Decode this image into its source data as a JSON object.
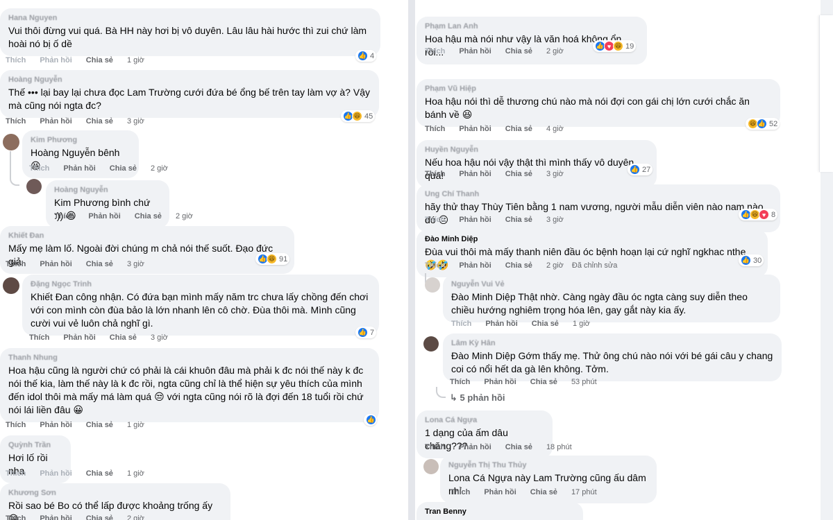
{
  "labels": {
    "like": "Thích",
    "reply": "Phản hồi",
    "share": "Chia sẻ"
  },
  "left": [
    {
      "author": "Hana Nguyen",
      "text": "Vui thôi đừng vui quá. Bà HH này hơi bị vô duyên. Lâu lâu hài hước thì zui chứ làm hoài nó bị ố dề",
      "time": "1 giờ",
      "count": "4"
    },
    {
      "author": "Hoàng Nguyễn",
      "text": "Thế ••• lại bay lại chưa đọc Lam Trường cưới đứa bé ổng bế trên tay làm vợ à? Vậy mà cũng nói ngta đc?",
      "time": "3 giờ",
      "count": "45"
    },
    {
      "author": "Kim Phương",
      "text": "Hoàng Nguyễn bênh 😆",
      "time": "2 giờ"
    },
    {
      "author": "Hoàng Nguyễn",
      "text": "Kim Phương bình chứ :)) 😆",
      "time": "2 giờ"
    },
    {
      "author": "Khiết Đan",
      "text": "Mấy mẹ làm lố. Ngoài đời chúng m chả nói thế suốt. Đạo đức giả",
      "time": "3 giờ",
      "count": "91"
    },
    {
      "author": "Đặng Ngọc Trinh",
      "text": "Khiết Đan công nhận. Có đứa bạn mình mấy năm trc chưa lấy chồng đến chơi với con mình còn đùa bảo là lớn nhanh lên cô chờ. Đùa thôi mà. Mình cũng cười vui vẻ luôn chả nghĩ gì.",
      "time": "3 giờ",
      "count": "7"
    },
    {
      "author": "Thanh Nhung",
      "text": "Hoa hậu cũng là người chứ có phải là cái khuôn đâu mà phải k đc nói thế này k đc nói thế kia, làm thế này là k đc rồi, ngta cũng chỉ là thể hiện sự yêu thích của mình đến idol thôi mà mấy má làm quá 😒 với ngta cũng nói rõ là đợi đến 18 tuổi rồi chứ nói lái liền đâu 😀",
      "time": "1 giờ"
    },
    {
      "author": "Quỳnh Trần",
      "text": "Hơi lố rồi nha",
      "time": "1 giờ"
    },
    {
      "author": "Khương Sơn",
      "text": "Rồi sao bé Bo có thể lấp được khoảng trống ấy 😁",
      "time": "2 giờ"
    }
  ],
  "right": [
    {
      "author": "Phạm Lan Anh",
      "text": "Hoa hậu mà nói như vậy là văn hoá không ổn rồi...",
      "time": "2 giờ",
      "count": "19"
    },
    {
      "author": "Phạm Vũ Hiệp",
      "text": "Hoa hậu nói thì dễ thương chú nào mà nói đợi con gái chị lớn cưới chắc ăn bánh về 😆",
      "time": "4 giờ",
      "count": "52"
    },
    {
      "author": "Huyền Nguyễn",
      "text": "Nếu hoa hậu nói vậy thật thì mình thấy vô duyên quá!",
      "time": "3 giờ",
      "count": "27"
    },
    {
      "author": "Ung Chí Thanh",
      "text": "hãy thử thay Thùy Tiên bằng 1 nam vương, người mẫu diễn viên nào nam nào đó 😐",
      "time": "3 giờ",
      "count": "8"
    },
    {
      "author": "Đào Minh Diệp",
      "text": "Đùa vui thôi mà mấy thanh niên đầu óc bệnh hoạn lại cứ nghĩ ngkhac nthe 🤣🤣",
      "time": "2 giờ",
      "count": "30",
      "edited": "Đã chỉnh sửa"
    },
    {
      "author": "Nguyễn Vui Vẻ",
      "text": "Đào Minh Diệp Thật nhờ. Càng ngày đầu óc ngta càng suy diễn theo chiều hướng nghiêm trọng hóa lên, gay gắt này kia ấy.",
      "time": "1 giờ"
    },
    {
      "author": "Lâm Kỳ Hân",
      "text": "Đào Minh Diệp Gớm thấy mẹ. Thử ông chú nào nói với bé gái câu y chang coi có nổi hết da gà lên không. Tởm.",
      "time": "53 phút"
    },
    {
      "author": "Lona Cá Ngựa",
      "text": "1 dạng của ấm dâu chăng???",
      "time": "18 phút"
    },
    {
      "author": "Nguyễn Thị Thu Thủy",
      "text": "Lona Cá Ngựa này Lam Trường cũng ấu dâm nhỉ",
      "time": "17 phút"
    },
    {
      "author": "Tran Benny"
    }
  ],
  "more_replies": "5 phản hồi",
  "edited_label": "Đã chỉnh sửa",
  "colors": {
    "bubble": "#f0f2f5",
    "like": "#1877f2",
    "haha": "#f7b928",
    "love": "#f33e58",
    "meta": "#65676b"
  },
  "icons": [
    "like-reaction-icon",
    "haha-reaction-icon",
    "love-reaction-icon",
    "reply-arrow-icon"
  ]
}
